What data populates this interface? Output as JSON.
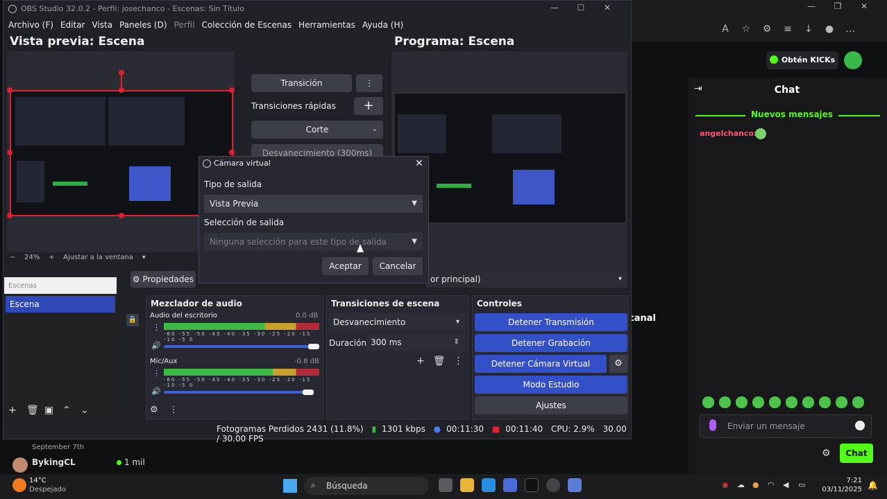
{
  "obs": {
    "title": "OBS Studio 32.0.2 - Perfil: josechanco - Escenas: Sin Título",
    "menu": [
      "Archivo (F)",
      "Editar",
      "Vista",
      "Paneles (D)",
      "Perfil",
      "Colección de Escenas",
      "Herramientas",
      "Ayuda (H)"
    ],
    "preview_heading": "Vista previa: Escena",
    "program_heading": "Programa: Escena",
    "transition_btn": "Transición",
    "quick_transitions": "Transiciones rápidas",
    "cut": "Corte",
    "fade_top": "Desvanecimiento (300ms)",
    "zoom": "24%",
    "fit_window": "Ajustar a la ventana",
    "properties": "Propiedades",
    "monitor": "or principal)",
    "scenes_header": "Escenas",
    "scene_item": "Escena",
    "mixer_title": "Mezclador de audio",
    "desktop_audio": "Audio del escritorio",
    "desktop_db": "0.0 dB",
    "mic_audio": "Mic/Aux",
    "mic_db": "-0.8 dB",
    "meter_scale": "-60 -55 -50 -45 -40 -35 -30 -25 -20 -15 -10 -5 0",
    "transitions_title": "Transiciones de escena",
    "transition_select": "Desvanecimiento",
    "duration_label": "Duración",
    "duration_value": "300 ms",
    "controls_title": "Controles",
    "stop_stream": "Detener Transmisión",
    "stop_record": "Detener Grabación",
    "stop_vcam": "Detener Cámara Virtual",
    "studio_mode": "Modo Estudio",
    "settings": "Ajustes",
    "status": {
      "dropped": "Fotogramas Perdidos 2431 (11.8%)",
      "bitrate": "1301 kbps",
      "stream_time": "00:11:30",
      "rec_time": "00:11:40",
      "cpu": "CPU: 2.9%",
      "fps": "30.00 / 30.00 FPS"
    }
  },
  "dialog": {
    "title": "Cámara virtual",
    "output_type_label": "Tipo de salida",
    "output_type_value": "Vista Previa",
    "output_sel_label": "Selección de salida",
    "output_sel_placeholder": "Ninguna selección para este tipo de salida",
    "accept": "Aceptar",
    "cancel": "Cancelar"
  },
  "browser": {
    "kicks_btn": "Obtén KICKs",
    "chat_title": "Chat",
    "new_messages": "Nuevos mensajes",
    "chat_user": "angelchanco:",
    "send_placeholder": "Enviar un mensaje",
    "chat_btn": "Chat",
    "canal": "canal",
    "list_date1": "September 7th",
    "list_user": "BykingCL",
    "list_count": "1 mil"
  },
  "taskbar": {
    "temp": "14°C",
    "weather": "Despejado",
    "search": "Búsqueda",
    "time": "7:21",
    "date": "03/11/2025"
  },
  "colors": {
    "kick_green": "#53fc18",
    "obs_blue": "#3450c9",
    "selection_red": "#e02030"
  },
  "icons": [
    "search-icon",
    "gear-icon",
    "close-icon",
    "plus-icon",
    "trash-icon",
    "chevron-down-icon",
    "mic-icon",
    "smile-icon",
    "lock-icon"
  ]
}
